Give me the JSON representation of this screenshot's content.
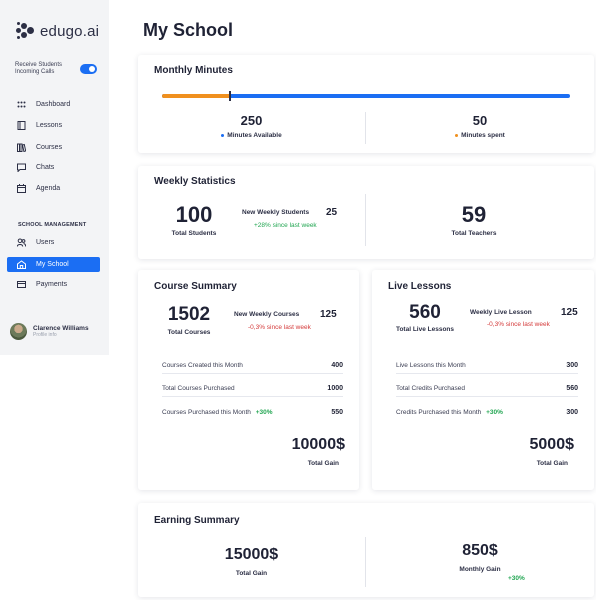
{
  "brand": {
    "name": "edugo.ai"
  },
  "toggle": {
    "label": "Receive Students Incoming Calls"
  },
  "nav": {
    "items": [
      {
        "label": "Dashboard",
        "icon": "grid-icon"
      },
      {
        "label": "Lessons",
        "icon": "book-icon"
      },
      {
        "label": "Courses",
        "icon": "books-icon"
      },
      {
        "label": "Chats",
        "icon": "chat-icon"
      },
      {
        "label": "Agenda",
        "icon": "calendar-icon"
      }
    ],
    "section_label": "SCHOOL MANAGEMENT",
    "management": [
      {
        "label": "Users",
        "icon": "users-icon"
      },
      {
        "label": "My School",
        "icon": "school-icon"
      },
      {
        "label": "Payments",
        "icon": "card-icon"
      }
    ]
  },
  "profile": {
    "name": "Clarence Williams",
    "sub": "Profile info"
  },
  "page": {
    "title": "My School"
  },
  "monthly_minutes": {
    "title": "Monthly Minutes",
    "spent_fraction": 0.167,
    "available_value": "250",
    "available_label": "Minutes Available",
    "spent_value": "50",
    "spent_label": "Minutes spent",
    "colors": {
      "available": "#1b6ef3",
      "spent": "#f0901e"
    }
  },
  "weekly": {
    "title": "Weekly Statistics",
    "students_value": "100",
    "students_label": "Total Students",
    "new_label": "New Weekly Students",
    "new_value": "25",
    "new_change": "+28% since last week",
    "teachers_value": "59",
    "teachers_label": "Total Teachers"
  },
  "course_summary": {
    "title": "Course Summary",
    "total_value": "1502",
    "total_label": "Total Courses",
    "new_label": "New Weekly Courses",
    "new_value": "125",
    "new_change": "-0,3% since last week",
    "rows": [
      {
        "label": "Courses Created this Month",
        "badge": "",
        "value": "400"
      },
      {
        "label": "Total Courses Purchased",
        "badge": "",
        "value": "1000"
      },
      {
        "label": "Courses Purchased this Month",
        "badge": "+30%",
        "value": "550"
      }
    ],
    "gain_value": "10000$",
    "gain_label": "Total Gain"
  },
  "live_lessons": {
    "title": "Live Lessons",
    "total_value": "560",
    "total_label": "Total Live Lessons",
    "new_label": "Weekly Live Lesson",
    "new_value": "125",
    "new_change": "-0,3% since last week",
    "rows": [
      {
        "label": "Live Lessons this Month",
        "badge": "",
        "value": "300"
      },
      {
        "label": "Total Credits Purchased",
        "badge": "",
        "value": "560"
      },
      {
        "label": "Credits Purchased this Month",
        "badge": "+30%",
        "value": "300"
      }
    ],
    "gain_value": "5000$",
    "gain_label": "Total Gain"
  },
  "earning": {
    "title": "Earning Summary",
    "total_value": "15000$",
    "total_label": "Total Gain",
    "monthly_value": "850$",
    "monthly_label": "Monthly Gain",
    "monthly_change": "+30%"
  }
}
